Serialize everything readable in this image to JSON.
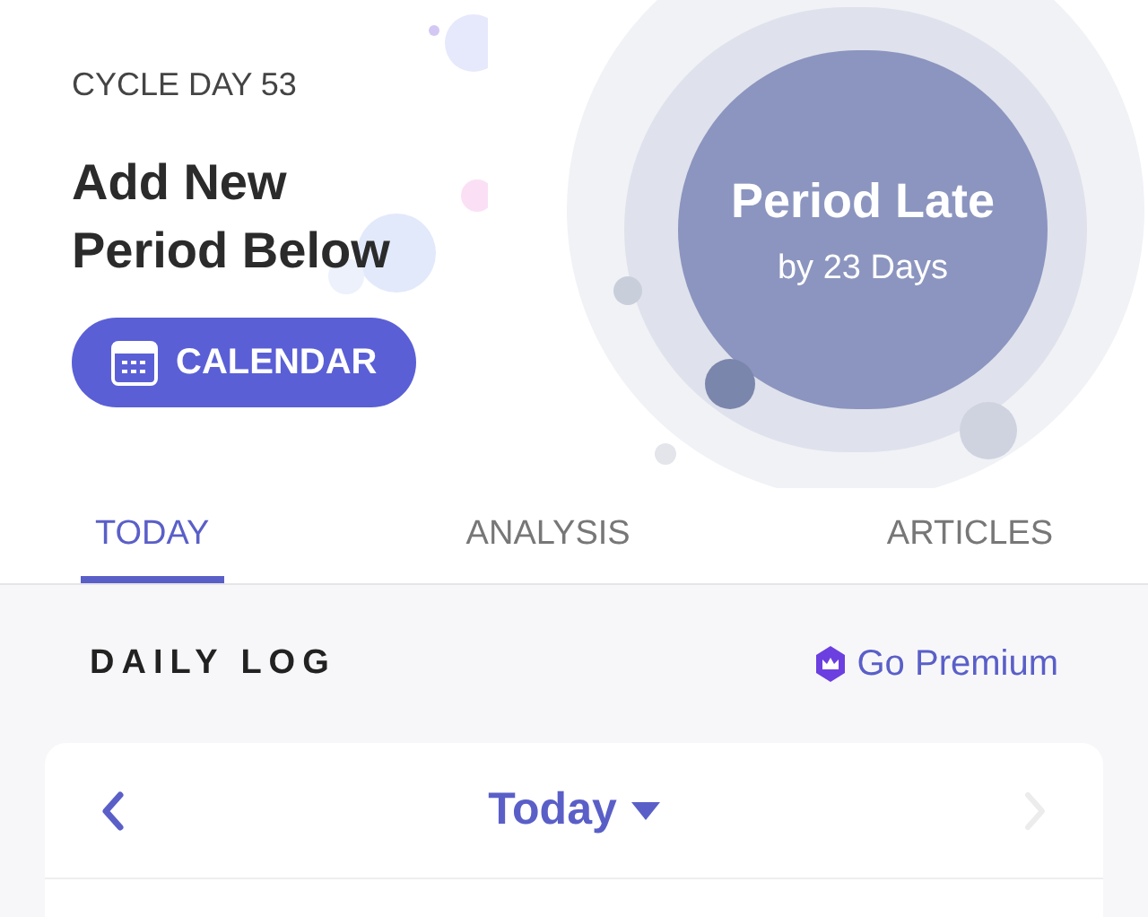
{
  "header": {
    "cycle_day": "CYCLE DAY 53",
    "headline": "Add New Period Below",
    "calendar_button": "CALENDAR"
  },
  "status_circle": {
    "title": "Period Late",
    "subtitle": "by 23 Days"
  },
  "tabs": [
    {
      "label": "TODAY",
      "selected": true
    },
    {
      "label": "ANALYSIS",
      "selected": false
    },
    {
      "label": "ARTICLES",
      "selected": false
    }
  ],
  "daily_log": {
    "title": "DAILY LOG",
    "premium_link": "Go Premium"
  },
  "date_nav": {
    "label": "Today",
    "prev_disabled": false,
    "next_disabled": true
  }
}
